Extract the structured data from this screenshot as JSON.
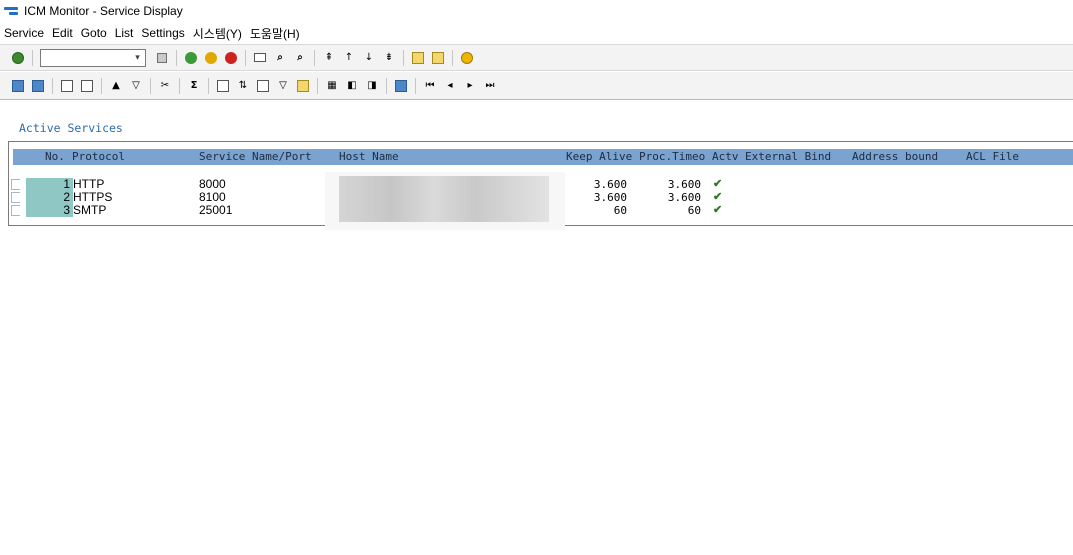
{
  "window": {
    "title": "ICM Monitor - Service Display"
  },
  "menubar": {
    "items": [
      "Service",
      "Edit",
      "Goto",
      "List",
      "Settings",
      "시스템(Y)",
      "도움말(H)"
    ]
  },
  "toolbar": {
    "command_field_value": "",
    "icons": {
      "enter": "check-icon",
      "save": "save-icon",
      "back": "back-icon",
      "exit": "exit-icon",
      "cancel": "cancel-icon",
      "print": "print-icon",
      "find": "find-icon",
      "find_next": "find-next-icon",
      "first_page": "first-page-icon",
      "prev_page": "prev-page-icon",
      "next_page": "next-page-icon",
      "last_page": "last-page-icon",
      "new_session": "new-session-icon",
      "shortcut": "shortcut-icon",
      "help": "help-icon"
    }
  },
  "app_toolbar": {
    "icons": [
      "refresh-icon",
      "detail-icon",
      "select-icon",
      "deselect-icon",
      "print-list-icon",
      "filter-icon",
      "cut-icon",
      "sum-icon",
      "export-icon",
      "sort-icon",
      "copy-icon",
      "filter-set-icon",
      "layout-icon",
      "grid-icon",
      "column-left-icon",
      "column-right-icon",
      "info-icon",
      "first-icon",
      "previous-icon",
      "next-icon",
      "last-icon"
    ]
  },
  "section": {
    "label": "Active Services"
  },
  "table": {
    "columns": [
      "No.",
      "Protocol",
      "Service Name/Port",
      "Host Name",
      "Keep Alive",
      "Proc.Timeo",
      "Actv",
      "External Bind",
      "Address bound",
      "ACL File"
    ],
    "rows": [
      {
        "no": "1",
        "protocol": "HTTP",
        "port": "8000",
        "keep_alive": "3.600",
        "proc_timeout": "3.600",
        "active": "✔"
      },
      {
        "no": "2",
        "protocol": "HTTPS",
        "port": "8100",
        "keep_alive": "3.600",
        "proc_timeout": "3.600",
        "active": "✔"
      },
      {
        "no": "3",
        "protocol": "SMTP",
        "port": "25001",
        "keep_alive": "60",
        "proc_timeout": "60",
        "active": "✔"
      }
    ]
  },
  "colors": {
    "header_bg": "#7aa3cf",
    "rownum_bg": "#8fc7c4",
    "section_label": "#2b6cb0",
    "active_check": "#2d7a1e"
  }
}
